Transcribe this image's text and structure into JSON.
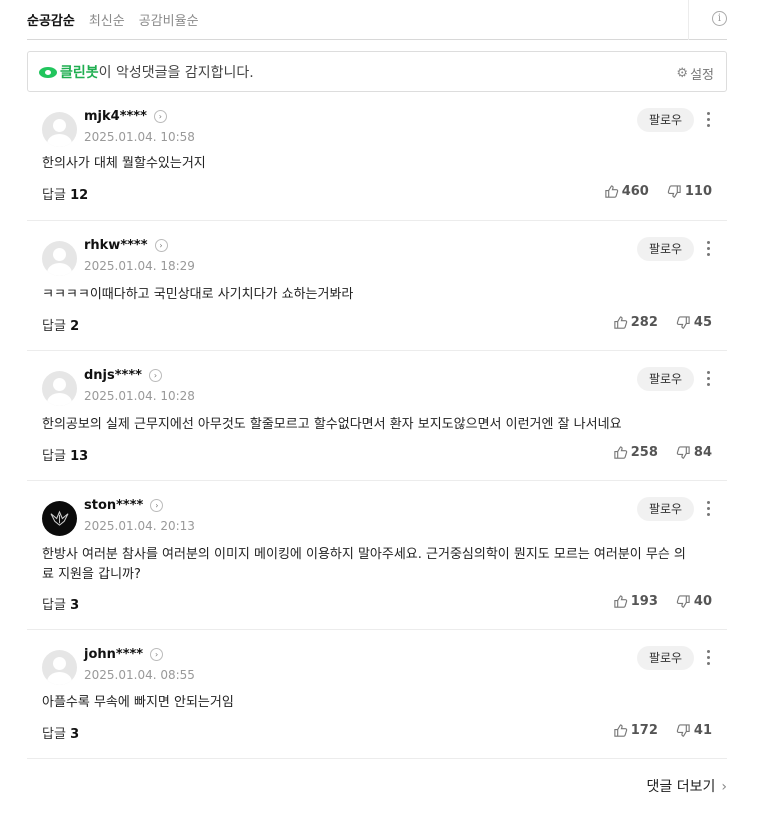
{
  "sort_tabs": [
    {
      "label": "순공감순",
      "active": true
    },
    {
      "label": "최신순",
      "active": false
    },
    {
      "label": "공감비율순",
      "active": false
    }
  ],
  "info_icon": "info-icon",
  "cleanbot": {
    "brand": "클린봇",
    "message": "이 악성댓글을 감지합니다.",
    "settings_label": "설정"
  },
  "comments": [
    {
      "user": "mjk4****",
      "date": "2025.01.04. 10:58",
      "text": "한의사가 대체 뭘할수있는거지",
      "reply_label": "답글",
      "reply_count": "12",
      "likes": "460",
      "dislikes": "110",
      "follow": "팔로우",
      "avatar": "default"
    },
    {
      "user": "rhkw****",
      "date": "2025.01.04. 18:29",
      "text": "ㅋㅋㅋㅋ이때다하고 국민상대로 사기치다가 쇼하는거봐라",
      "reply_label": "답글",
      "reply_count": "2",
      "likes": "282",
      "dislikes": "45",
      "follow": "팔로우",
      "avatar": "default"
    },
    {
      "user": "dnjs****",
      "date": "2025.01.04. 10:28",
      "text": "한의공보의 실제 근무지에선 아무것도 할줄모르고 할수없다면서 환자 보지도않으면서 이런거엔 잘 나서네요",
      "reply_label": "답글",
      "reply_count": "13",
      "likes": "258",
      "dislikes": "84",
      "follow": "팔로우",
      "avatar": "default"
    },
    {
      "user": "ston****",
      "date": "2025.01.04. 20:13",
      "text": "한방사 여러분 참사를 여러분의 이미지 메이킹에 이용하지 말아주세요. 근거중심의학이 뭔지도 모르는 여러분이 무슨 의료 지원을 갑니까?",
      "reply_label": "답글",
      "reply_count": "3",
      "likes": "193",
      "dislikes": "40",
      "follow": "팔로우",
      "avatar": "dark"
    },
    {
      "user": "john****",
      "date": "2025.01.04. 08:55",
      "text": "아플수록 무속에 빠지면 안되는거임",
      "reply_label": "답글",
      "reply_count": "3",
      "likes": "172",
      "dislikes": "41",
      "follow": "팔로우",
      "avatar": "default"
    }
  ],
  "more_label": "댓글 더보기",
  "colors": {
    "brand_green": "#1fae50",
    "follow_bg": "#f1f1f1"
  }
}
